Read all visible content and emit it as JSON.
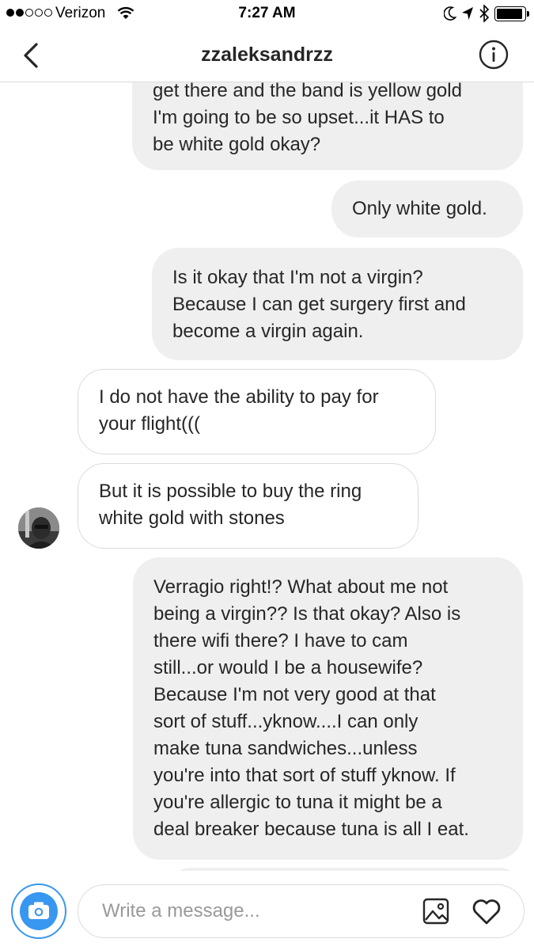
{
  "status_bar": {
    "carrier": "Verizon",
    "time": "7:27 AM",
    "signal_bars_filled": 2,
    "signal_bars_total": 5,
    "battery_level": 0.95,
    "icons": [
      "wifi-icon",
      "moon-icon",
      "location-arrow-icon",
      "bluetooth-icon",
      "battery-icon"
    ]
  },
  "header": {
    "title": "zzaleksandrzz",
    "back_icon": "chevron-left-icon",
    "info_icon": "info-circle-icon"
  },
  "messages": [
    {
      "direction": "outgoing",
      "lines": [
        "get there and the band is yellow gold",
        "I'm going to be so upset...it HAS to",
        "be white gold okay?"
      ]
    },
    {
      "direction": "outgoing",
      "lines": [
        "Only white gold."
      ]
    },
    {
      "direction": "outgoing",
      "lines": [
        "Is it okay that I'm not a virgin?",
        "Because I can get surgery first and",
        "become a virgin again."
      ]
    },
    {
      "direction": "incoming",
      "lines": [
        "I do not have the ability to pay for",
        "your flight((("
      ]
    },
    {
      "direction": "incoming",
      "lines": [
        "But it is possible to buy the ring",
        "white gold with stones"
      ]
    },
    {
      "direction": "outgoing",
      "lines": [
        "Verragio right!? What about me not",
        "being a virgin?? Is that okay? Also is",
        "there wifi there? I have to cam",
        "still...or would I be a housewife?",
        "Because I'm not very good at that",
        "sort of stuff...yknow....I can only",
        "make tuna sandwiches...unless",
        "you're into that sort of stuff yknow. If",
        "you're allergic to tuna it might be a",
        "deal breaker because tuna is all I eat."
      ]
    }
  ],
  "composer": {
    "placeholder": "Write a message...",
    "value": "",
    "camera_icon": "camera-icon",
    "gallery_icon": "image-gallery-icon",
    "like_icon": "heart-icon"
  },
  "colors": {
    "accent": "#3897f0",
    "outgoing_bubble": "#efefef",
    "incoming_border": "#dbdbdb",
    "text": "#262626"
  }
}
